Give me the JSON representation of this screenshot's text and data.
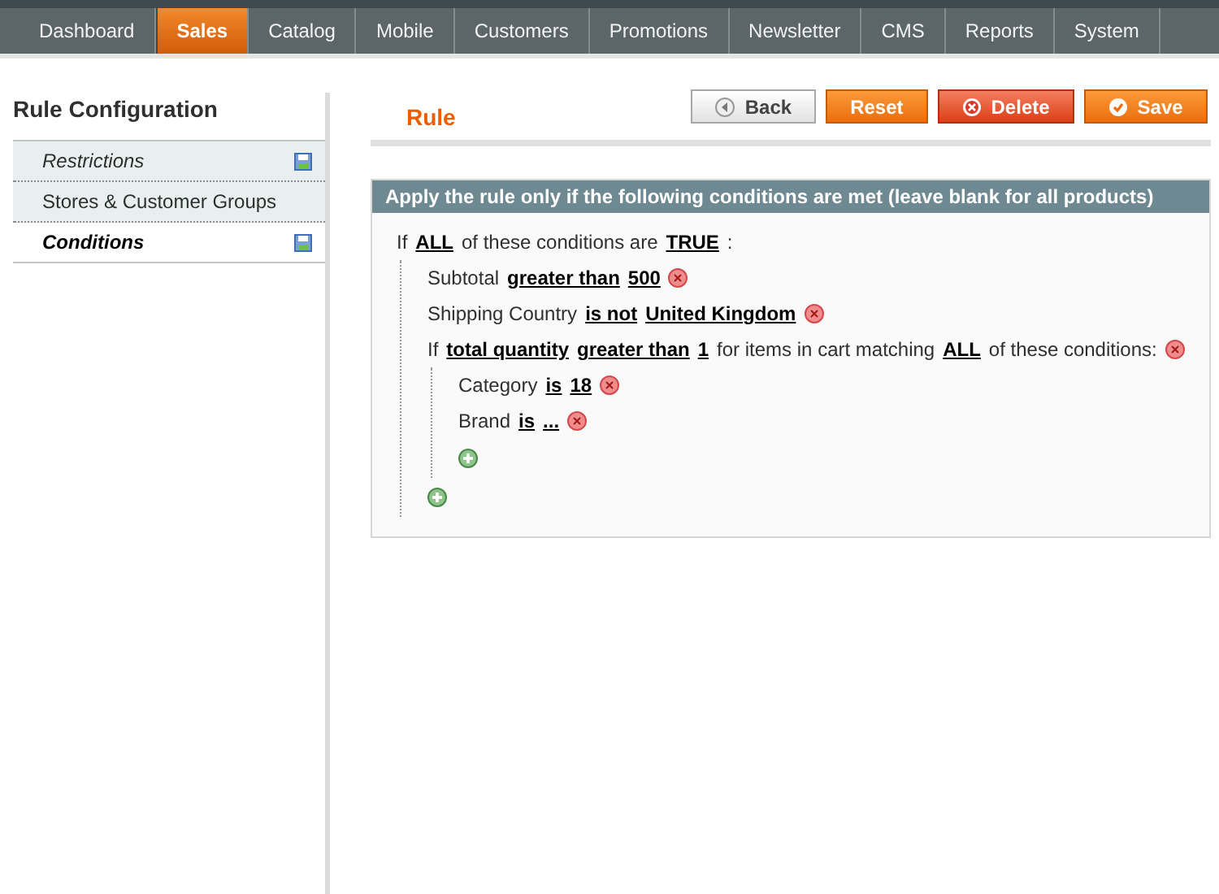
{
  "nav": [
    {
      "label": "Dashboard",
      "selected": false
    },
    {
      "label": "Sales",
      "selected": true
    },
    {
      "label": "Catalog",
      "selected": false
    },
    {
      "label": "Mobile",
      "selected": false
    },
    {
      "label": "Customers",
      "selected": false
    },
    {
      "label": "Promotions",
      "selected": false
    },
    {
      "label": "Newsletter",
      "selected": false
    },
    {
      "label": "CMS",
      "selected": false
    },
    {
      "label": "Reports",
      "selected": false
    },
    {
      "label": "System",
      "selected": false
    }
  ],
  "sidebar": {
    "title": "Rule Configuration",
    "items": [
      {
        "label": "Restrictions",
        "selected": false,
        "changed": true
      },
      {
        "label": "Stores & Customer Groups",
        "selected": false,
        "changed": false
      },
      {
        "label": "Conditions",
        "selected": true,
        "changed": true
      }
    ]
  },
  "page": {
    "title": "Rule",
    "buttons": [
      {
        "kind": "back",
        "label": "Back"
      },
      {
        "kind": "reset",
        "label": "Reset"
      },
      {
        "kind": "delete",
        "label": "Delete"
      },
      {
        "kind": "save",
        "label": "Save"
      }
    ]
  },
  "conditions": {
    "heading": "Apply the rule only if the following conditions are met (leave blank for all products)",
    "root": {
      "parts": [
        {
          "kind": "text",
          "text": "If"
        },
        {
          "kind": "link",
          "text": "ALL"
        },
        {
          "kind": "text",
          "text": "of these conditions are"
        },
        {
          "kind": "link",
          "text": "TRUE"
        },
        {
          "kind": "text",
          "text": ":"
        }
      ],
      "children": [
        {
          "parts": [
            {
              "kind": "text",
              "text": "Subtotal"
            },
            {
              "kind": "link",
              "text": "greater than"
            },
            {
              "kind": "link",
              "text": "500"
            }
          ]
        },
        {
          "parts": [
            {
              "kind": "text",
              "text": "Shipping Country"
            },
            {
              "kind": "link",
              "text": "is not"
            },
            {
              "kind": "link",
              "text": "United Kingdom"
            }
          ]
        },
        {
          "parts": [
            {
              "kind": "text",
              "text": "If"
            },
            {
              "kind": "link",
              "text": "total quantity"
            },
            {
              "kind": "link",
              "text": "greater than"
            },
            {
              "kind": "link",
              "text": "1"
            },
            {
              "kind": "text",
              "text": "for items in cart matching"
            },
            {
              "kind": "link",
              "text": "ALL"
            },
            {
              "kind": "text",
              "text": "of these conditions:"
            }
          ],
          "children": [
            {
              "parts": [
                {
                  "kind": "text",
                  "text": "Category"
                },
                {
                  "kind": "link",
                  "text": "is"
                },
                {
                  "kind": "link",
                  "text": "18"
                }
              ]
            },
            {
              "parts": [
                {
                  "kind": "text",
                  "text": "Brand"
                },
                {
                  "kind": "link",
                  "text": "is"
                },
                {
                  "kind": "link",
                  "text": "..."
                }
              ]
            }
          ]
        }
      ]
    }
  }
}
